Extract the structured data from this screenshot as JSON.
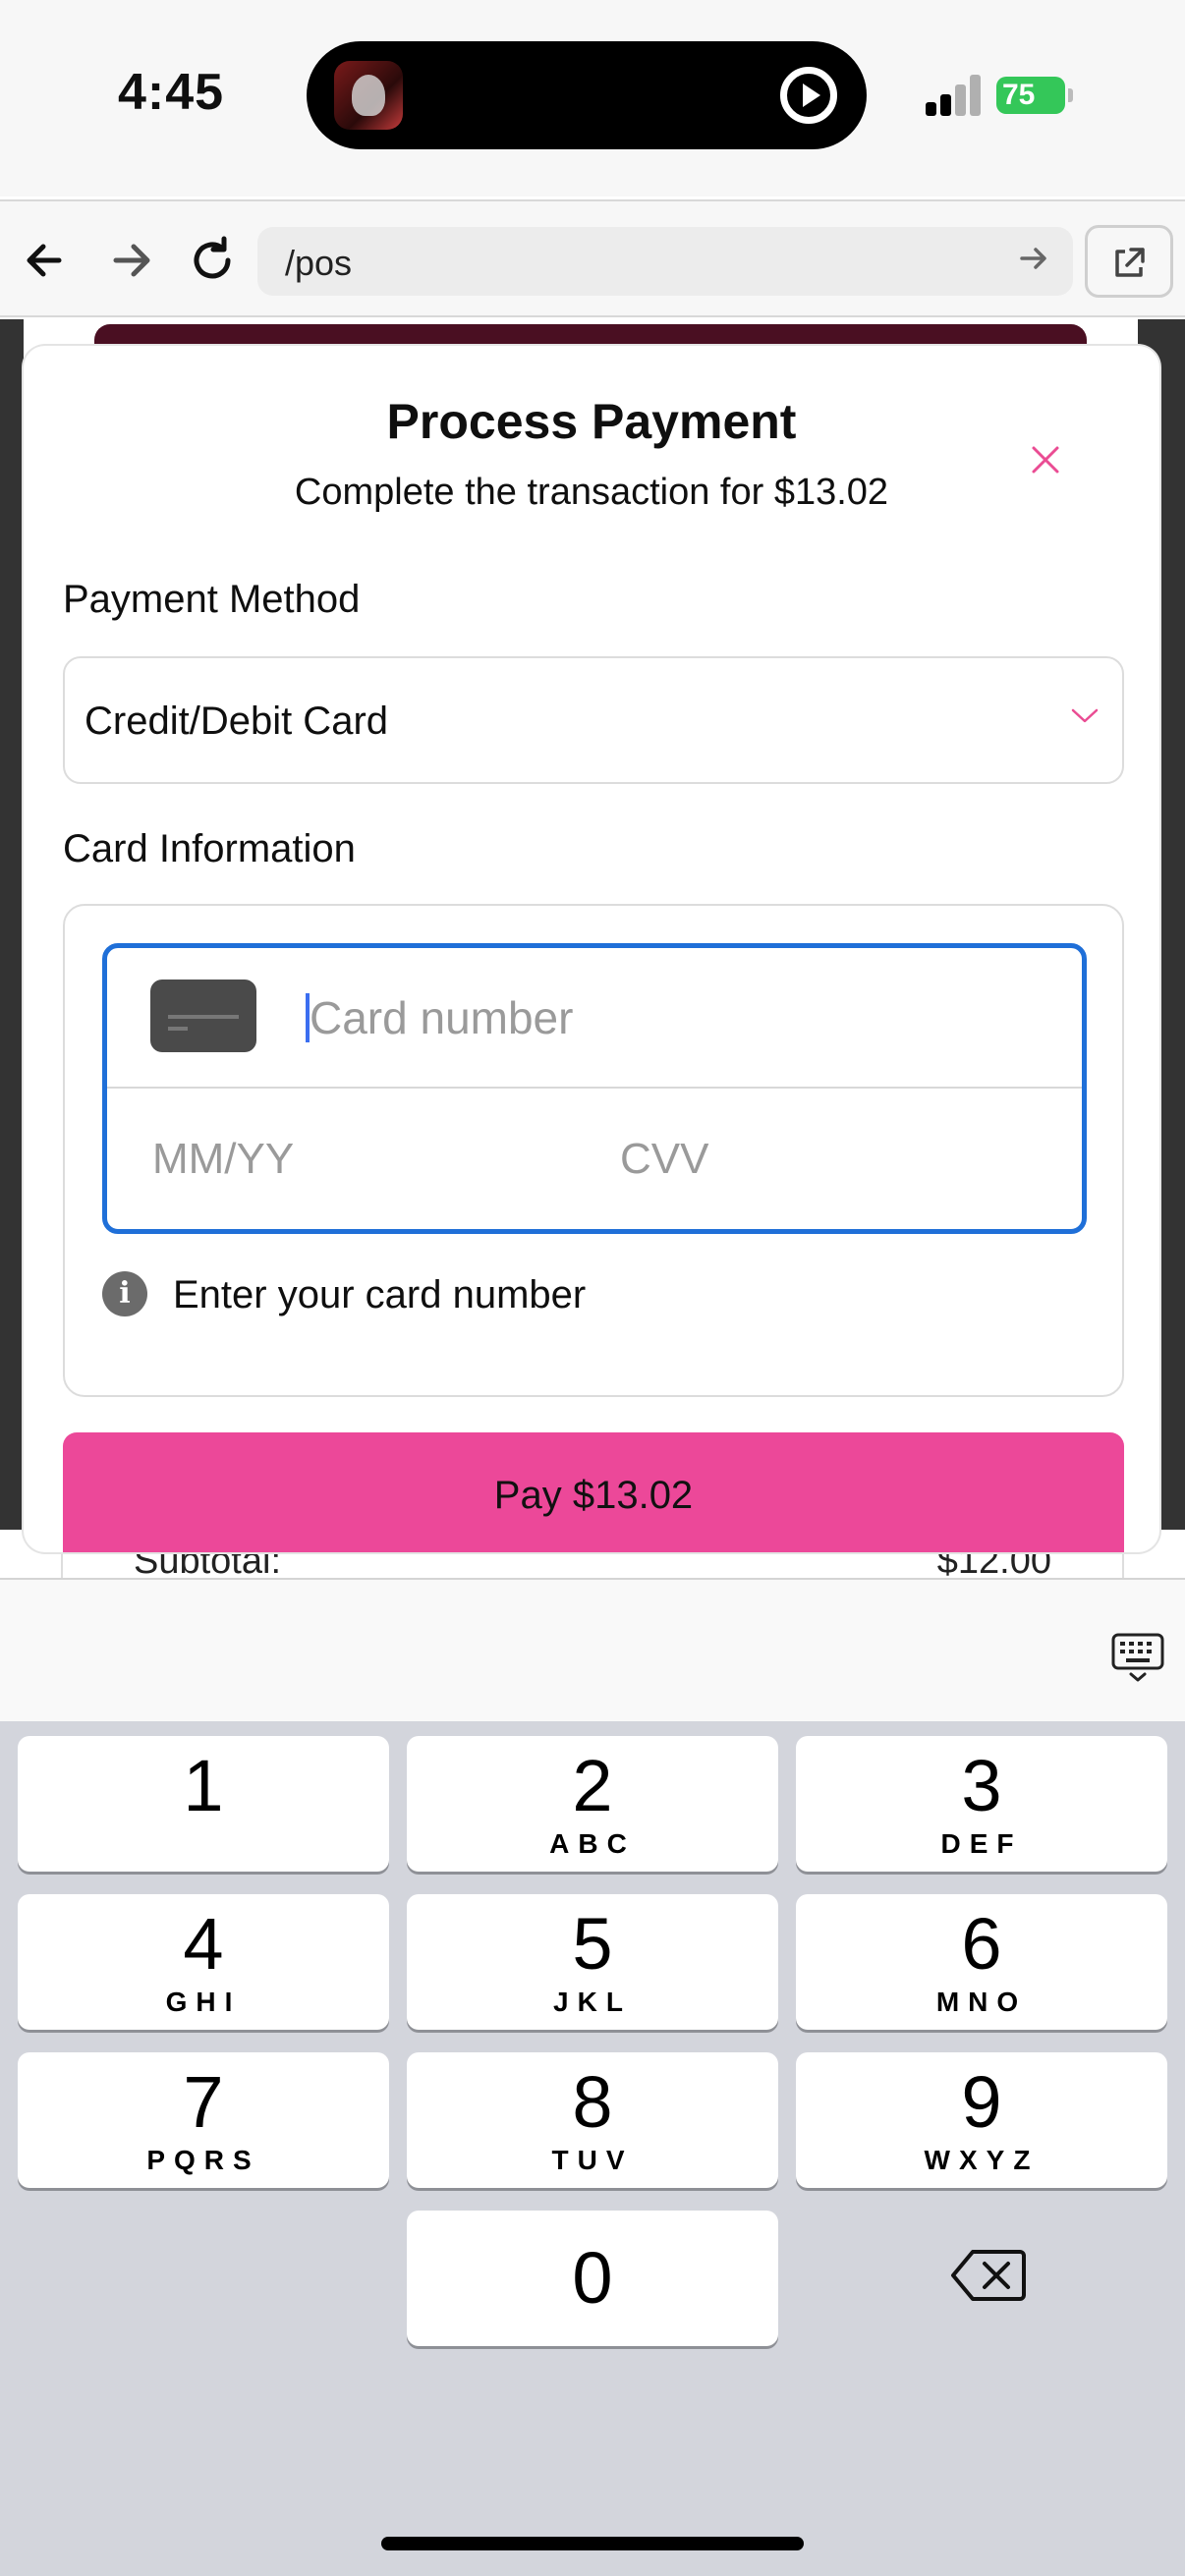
{
  "status_bar": {
    "time": "4:45",
    "battery": "75",
    "battery_color": "#34c759"
  },
  "browser": {
    "back_icon": "back-arrow-icon",
    "forward_icon": "forward-arrow-icon",
    "reload_icon": "reload-icon",
    "url": "/pos",
    "external_icon": "external-link-icon"
  },
  "background_page": {
    "subtotal_label": "Subtotal:",
    "subtotal_value": "$12.00"
  },
  "modal": {
    "title": "Process Payment",
    "subtitle": "Complete the transaction for $13.02",
    "close_icon": "close-icon",
    "payment_method_label": "Payment Method",
    "payment_method_value": "Credit/Debit Card",
    "card_info_label": "Card Information",
    "card_number_placeholder": "Card number",
    "expiry_placeholder": "MM/YY",
    "cvv_placeholder": "CVV",
    "hint": "Enter your card number",
    "pay_button": "Pay $13.02",
    "accent_color": "#ec4899",
    "focus_color": "#1f6fd8"
  },
  "keypad": {
    "keys": [
      {
        "digit": "1",
        "letters": ""
      },
      {
        "digit": "2",
        "letters": "ABC"
      },
      {
        "digit": "3",
        "letters": "DEF"
      },
      {
        "digit": "4",
        "letters": "GHI"
      },
      {
        "digit": "5",
        "letters": "JKL"
      },
      {
        "digit": "6",
        "letters": "MNO"
      },
      {
        "digit": "7",
        "letters": "PQRS"
      },
      {
        "digit": "8",
        "letters": "TUV"
      },
      {
        "digit": "9",
        "letters": "WXYZ"
      },
      {
        "digit": "0",
        "letters": ""
      }
    ],
    "delete_icon": "delete-icon",
    "keyboard_toggle_icon": "keyboard-icon"
  }
}
